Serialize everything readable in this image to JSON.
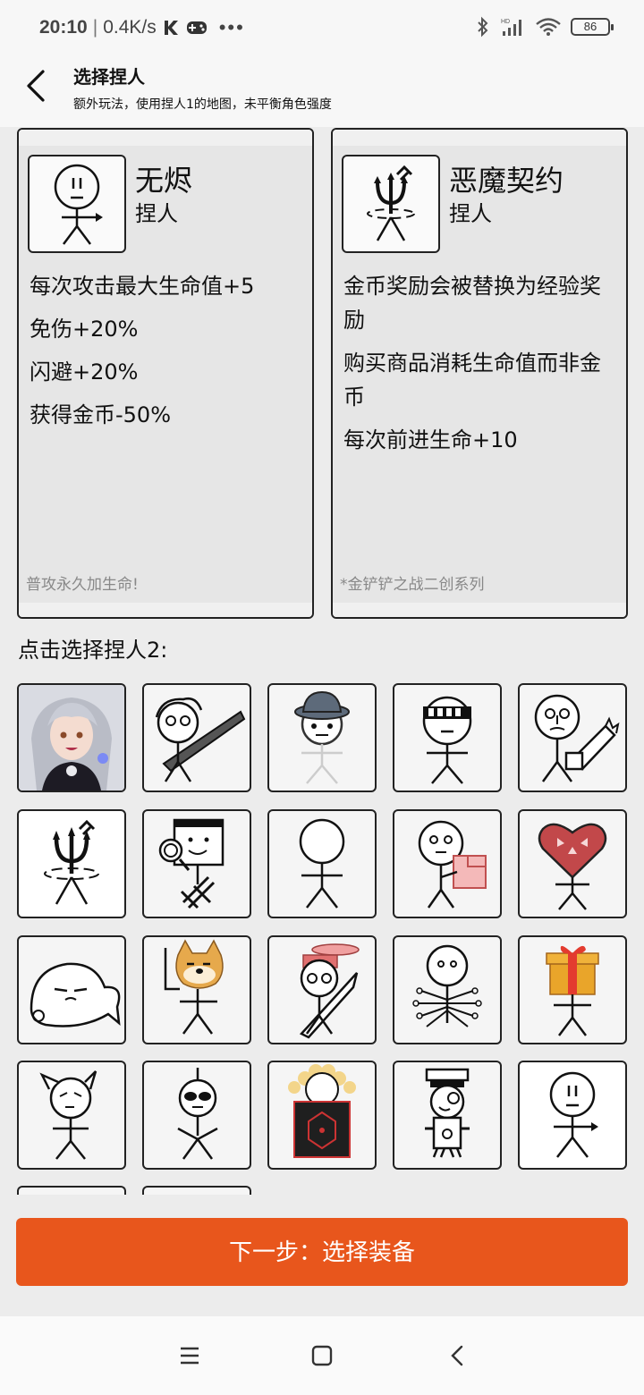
{
  "status": {
    "time": "20:10",
    "speed": "0.4K/s",
    "battery": "86"
  },
  "header": {
    "title": "选择捏人",
    "subtitle": "额外玩法，使用捏人1的地图，未平衡角色强度"
  },
  "cards": [
    {
      "name": "无烬",
      "kind": "捏人",
      "effects": [
        "每次攻击最大生命值+5",
        "免伤+20%",
        "闪避+20%",
        "获得金币-50%"
      ],
      "note": "普攻永久加生命!"
    },
    {
      "name": "恶魔契约",
      "kind": "捏人",
      "effects": [
        "金币奖励会被替换为经验奖励",
        "购买商品消耗生命值而非金币",
        "每次前进生命+10"
      ],
      "note": "*金铲铲之战二创系列"
    }
  ],
  "section_label": "点击选择捏人2:",
  "grid": [
    "anime-girl-avatar",
    "stickman-greatsword",
    "stickman-hat-faded",
    "stickman-visor",
    "stickman-chainsaw",
    "trident-icon",
    "stickman-magnifier",
    "stickman-plain",
    "stickman-pink-book",
    "heart-stickman",
    "lying-fish-blob",
    "doge-stickman",
    "stickman-sword-hat",
    "stickman-tentacles",
    "gift-stickman",
    "cat-ear-stickman",
    "sunglasses-stickman",
    "gold-shield-stickman",
    "monocle-robot",
    "stickman-arrow"
  ],
  "next_button": "下一步：选择装备",
  "colors": {
    "accent": "#e8561c",
    "heart": "#c2484a",
    "gift": "#e33b2f"
  }
}
